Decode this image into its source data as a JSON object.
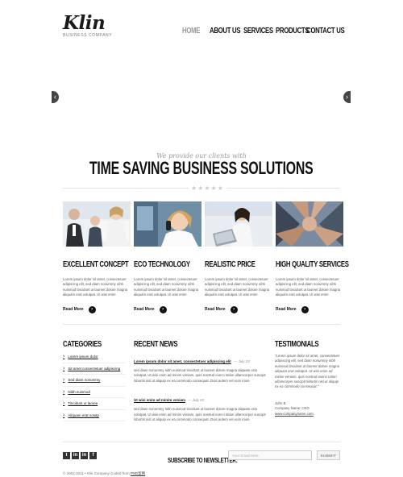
{
  "header": {
    "logo": "Klin",
    "logo_sub": "BUSINESS COMPANY",
    "nav": [
      {
        "label": "HOME",
        "active": true
      },
      {
        "label": "ABOUT US"
      },
      {
        "label": "SERVICES"
      },
      {
        "label": "PRODUCTS"
      },
      {
        "label": "CONTACT US"
      }
    ]
  },
  "slider": {
    "prev": "‹",
    "next": "›"
  },
  "intro": {
    "tagline": "We provide our clients with",
    "headline": "TIME SAVING BUSINESS SOLUTIONS",
    "stars": "★★★★★"
  },
  "features": [
    {
      "title": "EXCELLENT CONCEPT",
      "text": "Lorem ipsum dolor sit amet, consectetuer adipiscing elit, sed diam nonummy nibh euismod tincidunt ut laoreet dolore magna aliquam erat volutpat. Ut wisi enim",
      "more": "Read More"
    },
    {
      "title": "ECO TECHNOLOGY",
      "text": "Lorem ipsum dolor sit amet, consectetuer adipiscing elit, sed diam nonummy nibh euismod tincidunt ut laoreet dolore magna aliquam erat volutpat. Ut wisi enim",
      "more": "Read More"
    },
    {
      "title": "REALISTIC PRICE",
      "text": "Lorem ipsum dolor sit amet, consectetuer adipiscing elit, sed diam nonummy nibh euismod tincidunt ut laoreet dolore magna aliquam erat volutpat. Ut wisi enim",
      "more": "Read More"
    },
    {
      "title": "HIGH QUALITY SERVICES",
      "text": "Lorem ipsum dolor sit amet, consectetuer adipiscing elit, sed diam nonummy nibh euismod tincidunt ut laoreet dolore magna aliquam erat volutpat. Ut wisi enim",
      "more": "Read More"
    }
  ],
  "categories": {
    "title": "CATEGORIES",
    "items": [
      "Lorem ipsum dolor",
      "Sit amet consectetuer adipiscing",
      "Sed diam nonummy",
      "Nibh euismod",
      "Tincidunt ut laoree",
      "Aliquam erat volutp"
    ]
  },
  "recent_news": {
    "title": "RECENT NEWS",
    "items": [
      {
        "title": "Lorem ipsum dolor sit amet, consectetuer adipiscing elit",
        "date": "— July 23",
        "body": "sed diam nonummy nibh euismod tincidunt ut laoreet dolore magna aliquam erat volutpat. Ut wisi enim ad minim veniam, quis nostrud exerci tation ullamcorper suscipit lobortis nisl ut aliquip ex ea commodo consequat. Duis autem vel eum iriure"
      },
      {
        "title": "Ut wisi enim ad minim veniam",
        "date": "— July 23",
        "body": "sed diam nonummy nibh euismod tincidunt ut laoreet dolore magna aliquam erat volutpat. Ut wisi enim ad minim veniam, quis nostrud exerci tation ullamcorper suscipit lobortis nisl ut aliquip ex ea commodo consequat. Duis autem vel eum iriure"
      }
    ]
  },
  "testimonials": {
    "title": "TESTIMONIALS",
    "quote": "\"Lorem ipsum dolor sit amet, consectetuer adipiscing elit, sed diam nonummy nibh euismod tincidunt ut laoreet dolore magna aliquam erat volutpat. Ut wisi enim ad minim veniam, quis nostrud exerci tation ullamcorper suscipit lobortis nisl ut aliquip ex ea commodo consequat.\"",
    "author": "John B.",
    "company": "Company Name: CEO",
    "link": "www.companyname.com"
  },
  "footer": {
    "social": [
      "t",
      "in",
      "in",
      "f"
    ],
    "newsletter_label": "SUBSCRIBE TO NEWSLETTER:",
    "email_placeholder": "Your Email Here",
    "submit": "SUBMIT",
    "copyright": "© 2002-2011 • Klin Company Coded from ",
    "copyright_link": "PSD案例"
  }
}
